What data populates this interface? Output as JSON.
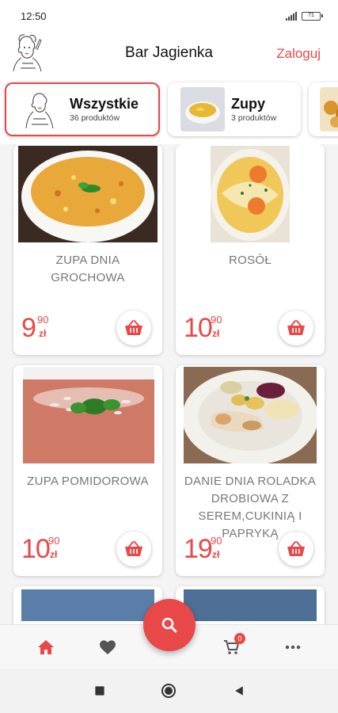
{
  "status_bar": {
    "time": "12:50",
    "battery": "71"
  },
  "header": {
    "logo": "bar-jagienka-logo",
    "title": "Bar Jagienka",
    "login_label": "Zaloguj"
  },
  "categories": [
    {
      "name": "Wszystkie",
      "count": "36 produktów",
      "active": true
    },
    {
      "name": "Zupy",
      "count": "3 produktów",
      "active": false
    }
  ],
  "products": [
    {
      "name": "ZUPA DNIA GROCHOWA",
      "price_main": "9",
      "price_cents": "90",
      "currency": "zł"
    },
    {
      "name": "ROSÓŁ",
      "price_main": "10",
      "price_cents": "90",
      "currency": "zł"
    },
    {
      "name": "ZUPA POMIDOROWA",
      "price_main": "10",
      "price_cents": "90",
      "currency": "zł"
    },
    {
      "name": "DANIE  DNIA ROLADKA DROBIOWA Z SEREM,CUKINIĄ I PAPRYKĄ",
      "price_main": "19",
      "price_cents": "90",
      "currency": "zł"
    }
  ],
  "bottom_nav": {
    "items": [
      "home-icon",
      "heart-icon",
      "cart-icon",
      "more-icon"
    ],
    "cart_count": "0",
    "fab_icon": "search-icon"
  },
  "system_nav": [
    "recents-icon",
    "home-circle-icon",
    "back-icon"
  ],
  "colors": {
    "accent": "#e84848",
    "text": "#222222",
    "muted": "#777777"
  }
}
